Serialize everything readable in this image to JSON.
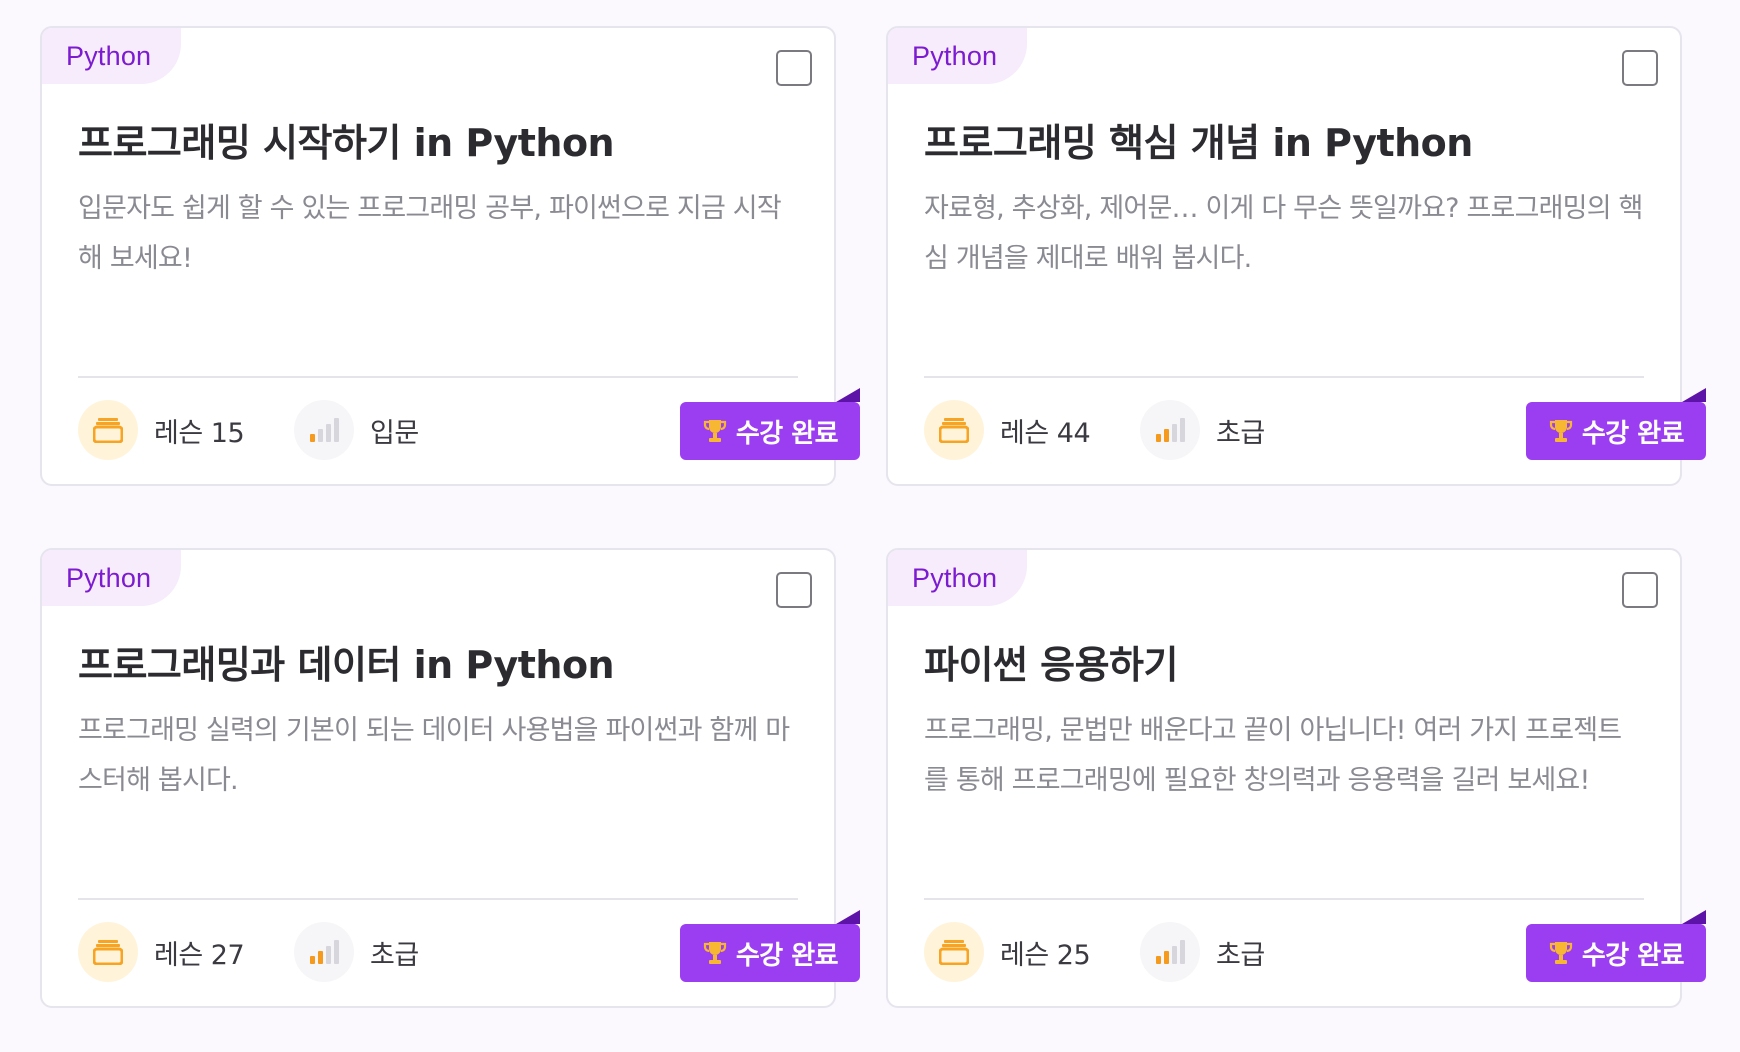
{
  "badge_label": "수강 완료",
  "colors": {
    "accent": "#9b3df0",
    "tag_text": "#7c1bd0",
    "tag_bg": "#f6ecfc",
    "lesson_icon": "#f7a323",
    "level_active": "#f59a1c"
  },
  "icons": {
    "lesson": "stack-icon",
    "level": "signal-bars-icon",
    "badge": "trophy-icon"
  },
  "courses": [
    {
      "tag": "Python",
      "title": "프로그래밍 시작하기 in Python",
      "description": "입문자도 쉽게 할 수 있는 프로그래밍 공부, 파이썬으로 지금 시작해 보세요!",
      "lessons": "레슨 15",
      "level": "입문",
      "level_bars": 1
    },
    {
      "tag": "Python",
      "title": "프로그래밍 핵심 개념 in Python",
      "description": "자료형, 추상화, 제어문… 이게 다 무슨 뜻일까요? 프로그래밍의 핵심 개념을 제대로 배워 봅시다.",
      "lessons": "레슨 44",
      "level": "초급",
      "level_bars": 2
    },
    {
      "tag": "Python",
      "title": "프로그래밍과 데이터 in Python",
      "description": "프로그래밍 실력의 기본이 되는 데이터 사용법을 파이썬과 함께 마스터해 봅시다.",
      "lessons": "레슨 27",
      "level": "초급",
      "level_bars": 2
    },
    {
      "tag": "Python",
      "title": "파이썬 응용하기",
      "description": "프로그래밍, 문법만 배운다고 끝이 아닙니다! 여러 가지 프로젝트를 통해 프로그래밍에 필요한 창의력과 응용력을 길러 보세요!",
      "lessons": "레슨 25",
      "level": "초급",
      "level_bars": 2
    }
  ]
}
